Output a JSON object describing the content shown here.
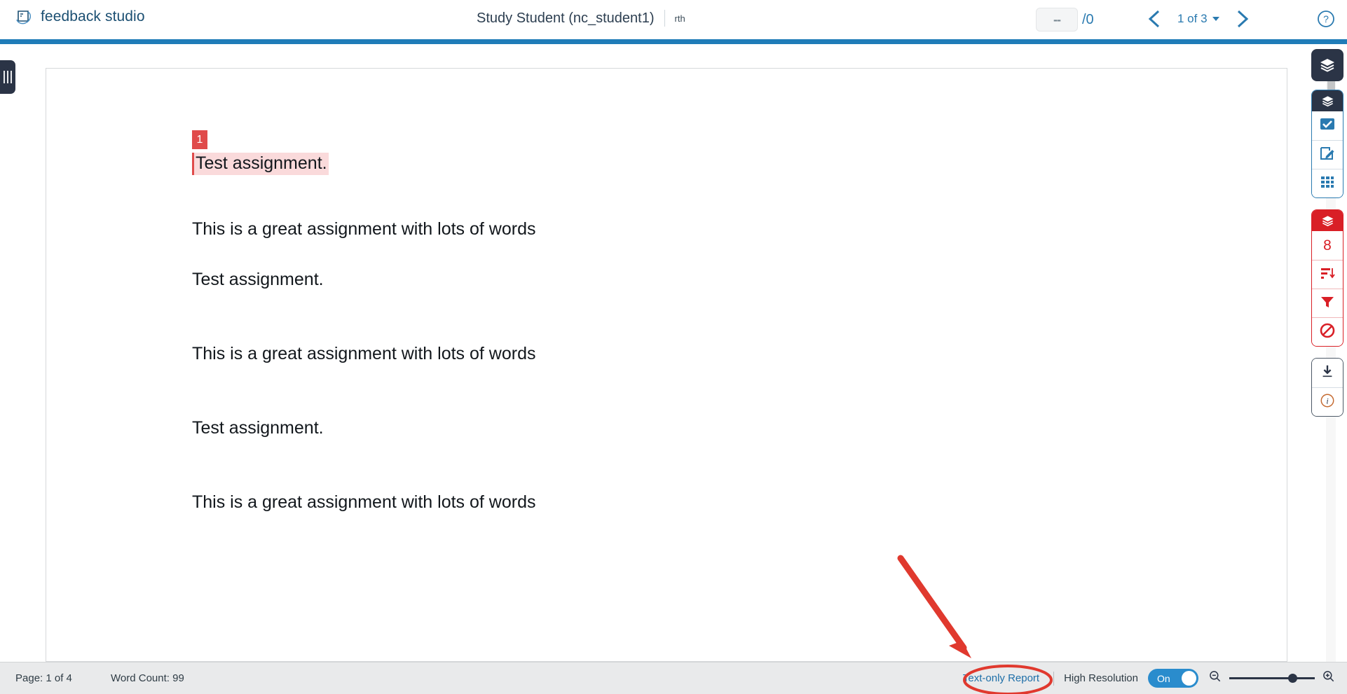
{
  "header": {
    "brand": "feedback studio",
    "brand_icon": "quote-mark-logo-icon",
    "doc_title": "Study Student (nc_student1)",
    "doc_subtitle": "rth",
    "grade_value": "--",
    "grade_total": "/0",
    "prev_icon": "chevron-left-icon",
    "next_icon": "chevron-right-icon",
    "page_label": "1 of 3",
    "help_icon": "question-circle-icon"
  },
  "left_panel": {
    "handle_icon": "grip-lines-vertical-icon"
  },
  "document": {
    "match_badge": "1",
    "match_text": "Test assignment.",
    "paragraphs": [
      "This is a great assignment with lots of words",
      "Test assignment.",
      "This is a great assignment with lots of words",
      "Test assignment.",
      "This is a great assignment with lots of words"
    ]
  },
  "toolbar": {
    "active_layers_icon": "layers-icon",
    "grading_header_icon": "layers-icon",
    "grading_tools": [
      {
        "icon": "checkmark-box-icon",
        "name": "quickmarks-tool"
      },
      {
        "icon": "pencil-square-icon",
        "name": "feedback-summary-tool"
      },
      {
        "icon": "grid-rubric-icon",
        "name": "rubric-tool"
      }
    ],
    "similarity_header_icon": "layers-icon",
    "similarity_score": "8",
    "similarity_tools": [
      {
        "icon": "match-overview-icon",
        "name": "match-overview-tool"
      },
      {
        "icon": "filter-funnel-icon",
        "name": "filters-and-settings-tool"
      },
      {
        "icon": "no-entry-icon",
        "name": "excluded-sources-tool"
      }
    ],
    "utility_tools": [
      {
        "icon": "download-icon",
        "name": "download-tool"
      },
      {
        "icon": "info-circle-icon",
        "name": "submission-info-tool"
      }
    ]
  },
  "status_bar": {
    "page_info": "Page: 1 of 4",
    "word_count": "Word Count: 99",
    "text_only_report": "Text-only Report",
    "high_resolution_label": "High Resolution",
    "high_resolution_state": "On",
    "zoom_out_icon": "magnifier-minus-icon",
    "zoom_in_icon": "magnifier-plus-icon"
  },
  "annotations": {
    "arrow_icon": "red-arrow-icon",
    "highlight_icon": "red-ellipse-highlight-icon",
    "accent_red": "#e0392e",
    "accent_blue": "#1f7cb8"
  }
}
